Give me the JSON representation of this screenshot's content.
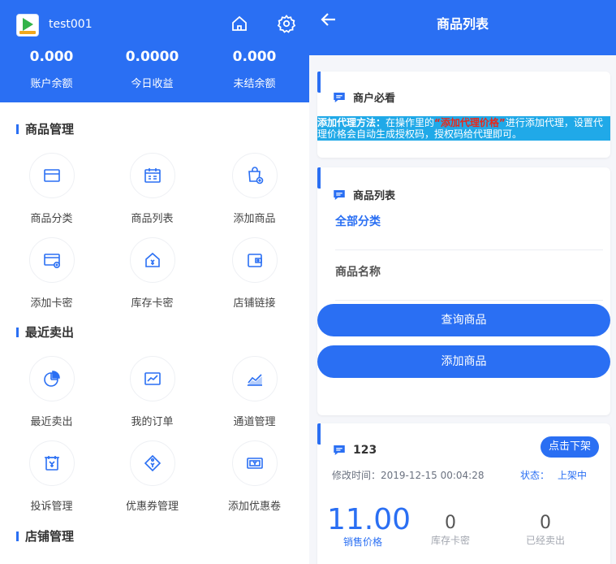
{
  "left": {
    "username": "test001",
    "stats": [
      {
        "value": "0.000",
        "label": "账户余额"
      },
      {
        "value": "0.0000",
        "label": "今日收益"
      },
      {
        "value": "0.000",
        "label": "未结余额"
      }
    ],
    "sections": [
      {
        "title": "商品管理",
        "items": [
          {
            "label": "商品分类",
            "icon": "card-icon"
          },
          {
            "label": "商品列表",
            "icon": "calendar-list-icon"
          },
          {
            "label": "添加商品",
            "icon": "add-product-icon"
          },
          {
            "label": "添加卡密",
            "icon": "add-card-icon"
          },
          {
            "label": "库存卡密",
            "icon": "stock-home-icon"
          },
          {
            "label": "店铺链接",
            "icon": "shop-link-icon"
          }
        ]
      },
      {
        "title": "最近卖出",
        "items": [
          {
            "label": "最近卖出",
            "icon": "pie-chart-icon"
          },
          {
            "label": "我的订单",
            "icon": "line-chart-icon"
          },
          {
            "label": "通道管理",
            "icon": "area-chart-icon"
          },
          {
            "label": "投诉管理",
            "icon": "complaint-icon"
          },
          {
            "label": "优惠券管理",
            "icon": "coupon-tag-icon"
          },
          {
            "label": "添加优惠卷",
            "icon": "add-coupon-icon"
          }
        ]
      },
      {
        "title": "店铺管理",
        "items": []
      }
    ]
  },
  "right": {
    "title": "商品列表",
    "notice_card": {
      "title": "商户必看",
      "notice_prefix": "添加代理方法：",
      "notice_mid1": "在操作里的",
      "notice_highlight": "“添加代理价格”",
      "notice_mid2": "进行添加代理，设置代理价格会自动生成授权码，授权码给代理即可。"
    },
    "list_card": {
      "title": "商品列表",
      "category_value": "全部分类",
      "name_placeholder": "商品名称",
      "query_button": "查询商品",
      "add_button": "添加商品"
    },
    "product": {
      "name": "123",
      "action": "点击下架",
      "modified_label": "修改时间：",
      "modified_time": "2019-12-15 00:04:28",
      "status_label": "状态：",
      "status_value": "上架中",
      "price": "11.00",
      "price_label": "销售价格",
      "stock": "0",
      "stock_label": "库存卡密",
      "sold": "0",
      "sold_label": "已经卖出"
    }
  },
  "colors": {
    "primary": "#2a6ff3",
    "notice_bg": "#20a9e8",
    "notice_red": "#e8281b"
  }
}
